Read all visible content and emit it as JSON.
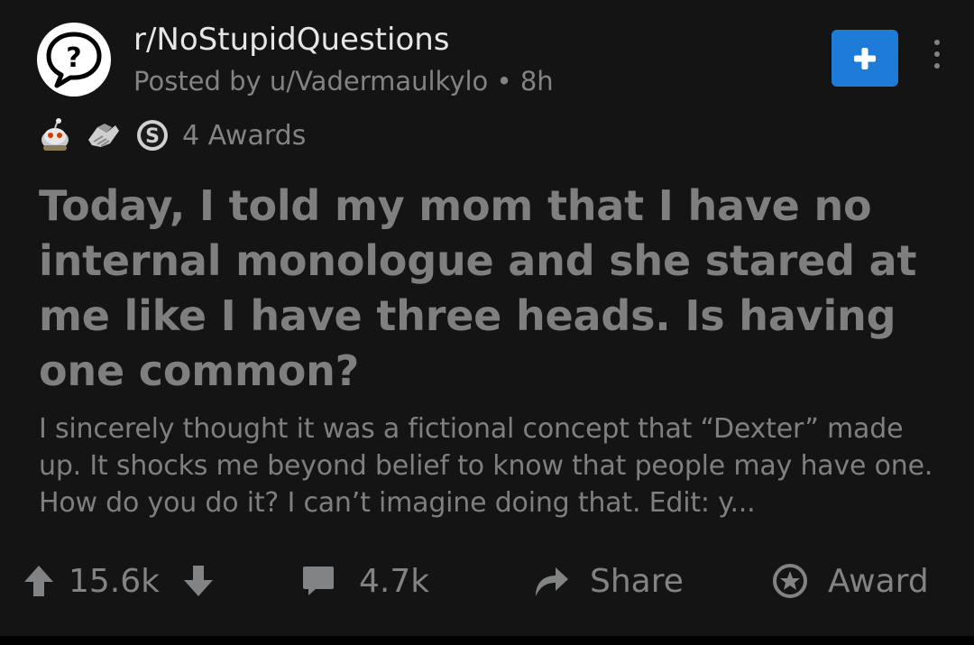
{
  "post": {
    "subreddit": "r/NoStupidQuestions",
    "posted_by": "Posted by u/Vadermaulkylo",
    "separator": "•",
    "age": "8h",
    "awards_label": "4 Awards",
    "awards_icons": [
      "snoo-award-icon",
      "handshake-award-icon",
      "silver-award-icon"
    ],
    "title": "Today, I told my mom that I have no internal monologue and she stared at me like I have three heads. Is having one common?",
    "body_preview": "I sincerely thought it was a fictional concept that “Dexter” made up. It shocks me beyond belief to know that people may have one.  How do you do it? I can’t imagine doing that. Edit: y..."
  },
  "actions": {
    "score": "15.6k",
    "comments": "4.7k",
    "share_label": "Share",
    "award_label": "Award"
  },
  "colors": {
    "background": "#141414",
    "join_button": "#1f7bd8",
    "muted_text": "#818384",
    "title_text": "#7f7f7f"
  }
}
